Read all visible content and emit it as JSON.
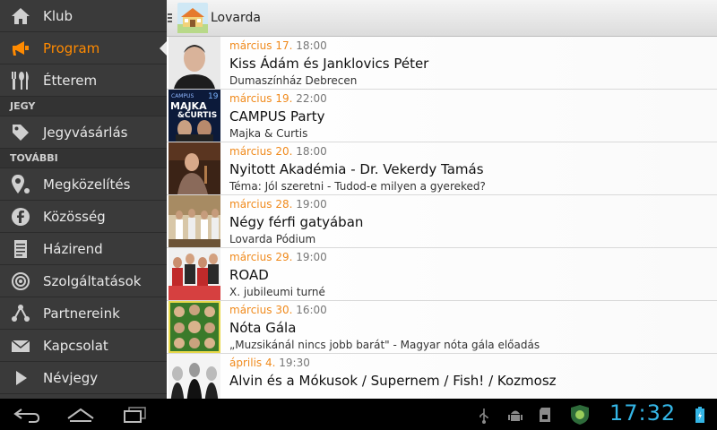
{
  "sidebar": {
    "items_top": [
      {
        "label": "Klub",
        "icon": "home-icon",
        "active": false
      },
      {
        "label": "Program",
        "icon": "megaphone-icon",
        "active": true
      },
      {
        "label": "Étterem",
        "icon": "cutlery-icon",
        "active": false
      }
    ],
    "section_jegy": "JEGY",
    "items_jegy": [
      {
        "label": "Jegyvásárlás",
        "icon": "tag-icon"
      }
    ],
    "section_tovabbi": "TOVÁBBI",
    "items_tovabbi": [
      {
        "label": "Megközelítés",
        "icon": "map-pin-icon"
      },
      {
        "label": "Közösség",
        "icon": "facebook-icon"
      },
      {
        "label": "Házirend",
        "icon": "document-icon"
      },
      {
        "label": "Szolgáltatások",
        "icon": "target-icon"
      },
      {
        "label": "Partnereink",
        "icon": "share-icon"
      },
      {
        "label": "Kapcsolat",
        "icon": "mail-icon"
      },
      {
        "label": "Névjegy",
        "icon": "play-icon"
      }
    ]
  },
  "actionbar": {
    "title": "Lovarda"
  },
  "events": [
    {
      "date": "március 17.",
      "time": "18:00",
      "title": "Kiss Ádám és Janklovics Péter",
      "subtitle": "Dumaszínház Debrecen"
    },
    {
      "date": "március 19.",
      "time": "22:00",
      "title": "CAMPUS Party",
      "subtitle": "Majka & Curtis"
    },
    {
      "date": "március 20.",
      "time": "18:00",
      "title": "Nyitott Akadémia - Dr. Vekerdy Tamás",
      "subtitle": "Téma: Jól szeretni - Tudod-e milyen a gyereked?"
    },
    {
      "date": "március 28.",
      "time": "19:00",
      "title": "Négy férfi gatyában",
      "subtitle": "Lovarda Pódium"
    },
    {
      "date": "március 29.",
      "time": "19:00",
      "title": "ROAD",
      "subtitle": "X. jubileumi turné"
    },
    {
      "date": "március 30.",
      "time": "16:00",
      "title": "Nóta Gála",
      "subtitle": "„Muzsikánál nincs jobb barát\" - Magyar nóta gála előadás"
    },
    {
      "date": "április 4.",
      "time": "19:30",
      "title": "Alvin és a Mókusok / Supernem / Fish! / Kozmosz",
      "subtitle": ""
    }
  ],
  "thumb_text": {
    "campus_num": "19",
    "campus_top": "CAMPUS",
    "campus_main": "MAJKA",
    "campus_sub": "&CURTIS"
  },
  "statusbar": {
    "clock": "17:32"
  },
  "colors": {
    "accent": "#ff8a00",
    "date": "#f08a1c",
    "clock": "#34b5e5"
  }
}
